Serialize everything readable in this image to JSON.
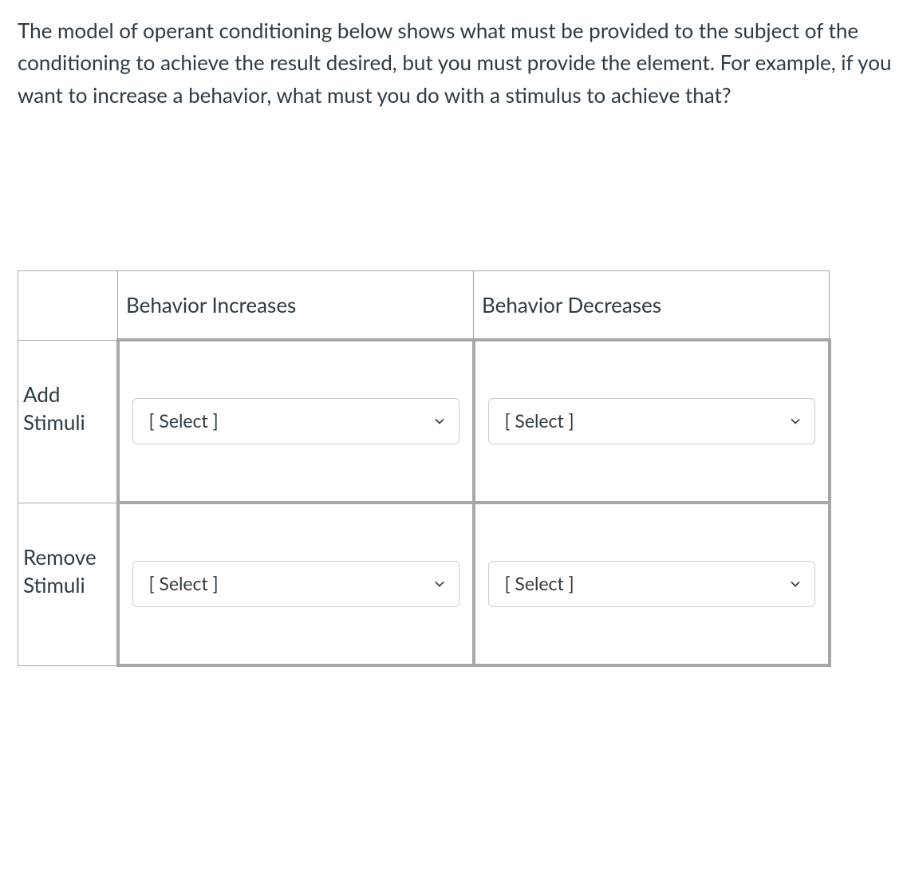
{
  "question": {
    "prompt": "The model of operant conditioning below shows what must be provided to the subject of the conditioning to achieve the result desired, but you must provide the element. For example, if you want to increase a behavior, what must you do with a stimulus to achieve that?"
  },
  "table": {
    "columns": {
      "col1": "Behavior Increases",
      "col2": "Behavior Decreases"
    },
    "rows": {
      "row1_label": "Add Stimuli",
      "row2_label": "Remove Stimuli"
    },
    "select_placeholder": "[ Select ]"
  }
}
